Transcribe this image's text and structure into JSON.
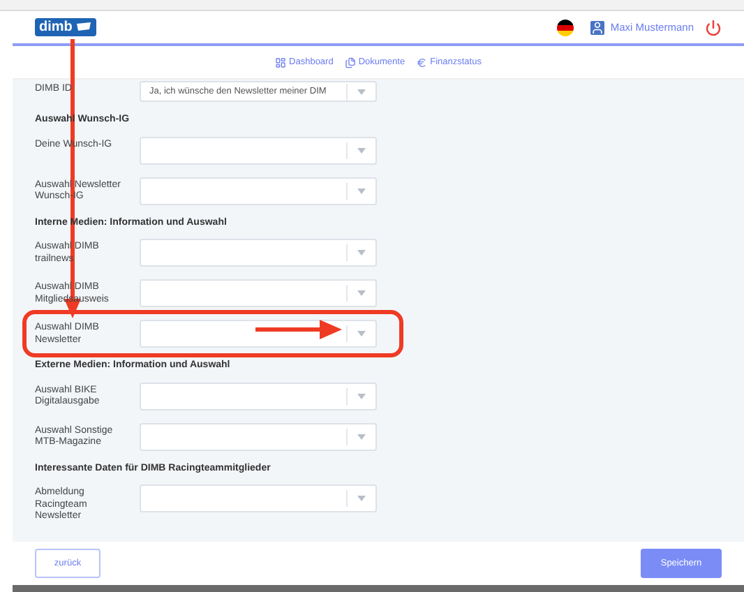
{
  "header": {
    "logo": "dimb",
    "user": "Maxi Mustermann"
  },
  "nav": [
    {
      "kind": "dashboard",
      "label": "Dashboard"
    },
    {
      "kind": "documents",
      "label": "Dokumente"
    },
    {
      "kind": "finance",
      "label": "Finanzstatus"
    }
  ],
  "sections": [
    {
      "rows": [
        {
          "label": "DIMB ID",
          "value": "Ja, ich wünsche den Newsletter meiner DIM",
          "highlighted": false
        }
      ]
    },
    {
      "heading": "Auswahl Wunsch-IG",
      "rows": [
        {
          "label": "Deine Wunsch-IG",
          "highlighted": false
        },
        {
          "label": "Auswahl Newsletter Wunsch-IG",
          "highlighted": false
        }
      ]
    },
    {
      "heading": "Interne Medien: Information und Auswahl",
      "rows": [
        {
          "label": "Auswahl DIMB trailnews",
          "highlighted": false
        },
        {
          "label": "Auswahl DIMB Mitgliedsausweis",
          "highlighted": false
        },
        {
          "label": "Auswahl DIMB Newsletter",
          "highlighted": true
        }
      ]
    },
    {
      "heading": "Externe Medien: Information und Auswahl",
      "rows": [
        {
          "label": "Auswahl BIKE Digitalausgabe",
          "highlighted": false
        },
        {
          "label": "Auswahl Sonstige MTB-Magazine",
          "highlighted": false
        }
      ]
    },
    {
      "heading": "Interessante Daten für DIMB Racingteammitglieder",
      "rows": [
        {
          "label": "Abmeldung Racingteam Newsletter",
          "highlighted": false
        }
      ]
    }
  ],
  "buttons": {
    "back": "zurück",
    "save": "Speichern"
  }
}
